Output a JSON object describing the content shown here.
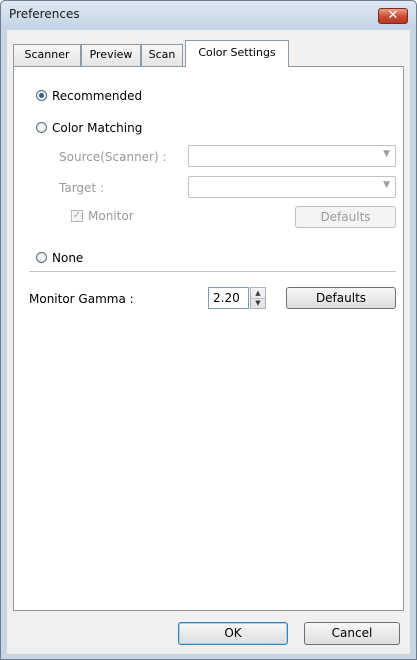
{
  "window": {
    "title": "Preferences",
    "close_glyph": "✕",
    "close_icon": "close-icon"
  },
  "tabs": [
    {
      "label": "Scanner",
      "active": false
    },
    {
      "label": "Preview",
      "active": false
    },
    {
      "label": "Scan",
      "active": false
    },
    {
      "label": "Color Settings",
      "active": true
    }
  ],
  "color_settings": {
    "recommended_label": "Recommended",
    "recommended_selected": true,
    "color_matching_label": "Color Matching",
    "color_matching_selected": false,
    "source_label": "Source(Scanner) :",
    "source_value": "",
    "target_label": "Target :",
    "target_value": "",
    "monitor_label": "Monitor",
    "monitor_checked": true,
    "matching_defaults_label": "Defaults",
    "none_label": "None",
    "none_selected": false,
    "monitor_gamma_label": "Monitor Gamma :",
    "monitor_gamma_value": "2.20",
    "gamma_defaults_label": "Defaults"
  },
  "footer": {
    "ok_label": "OK",
    "cancel_label": "Cancel"
  },
  "colors": {
    "accent": "#2b5fa3",
    "close_button": "#c94c33",
    "window_frame": "#c8d6e4"
  }
}
